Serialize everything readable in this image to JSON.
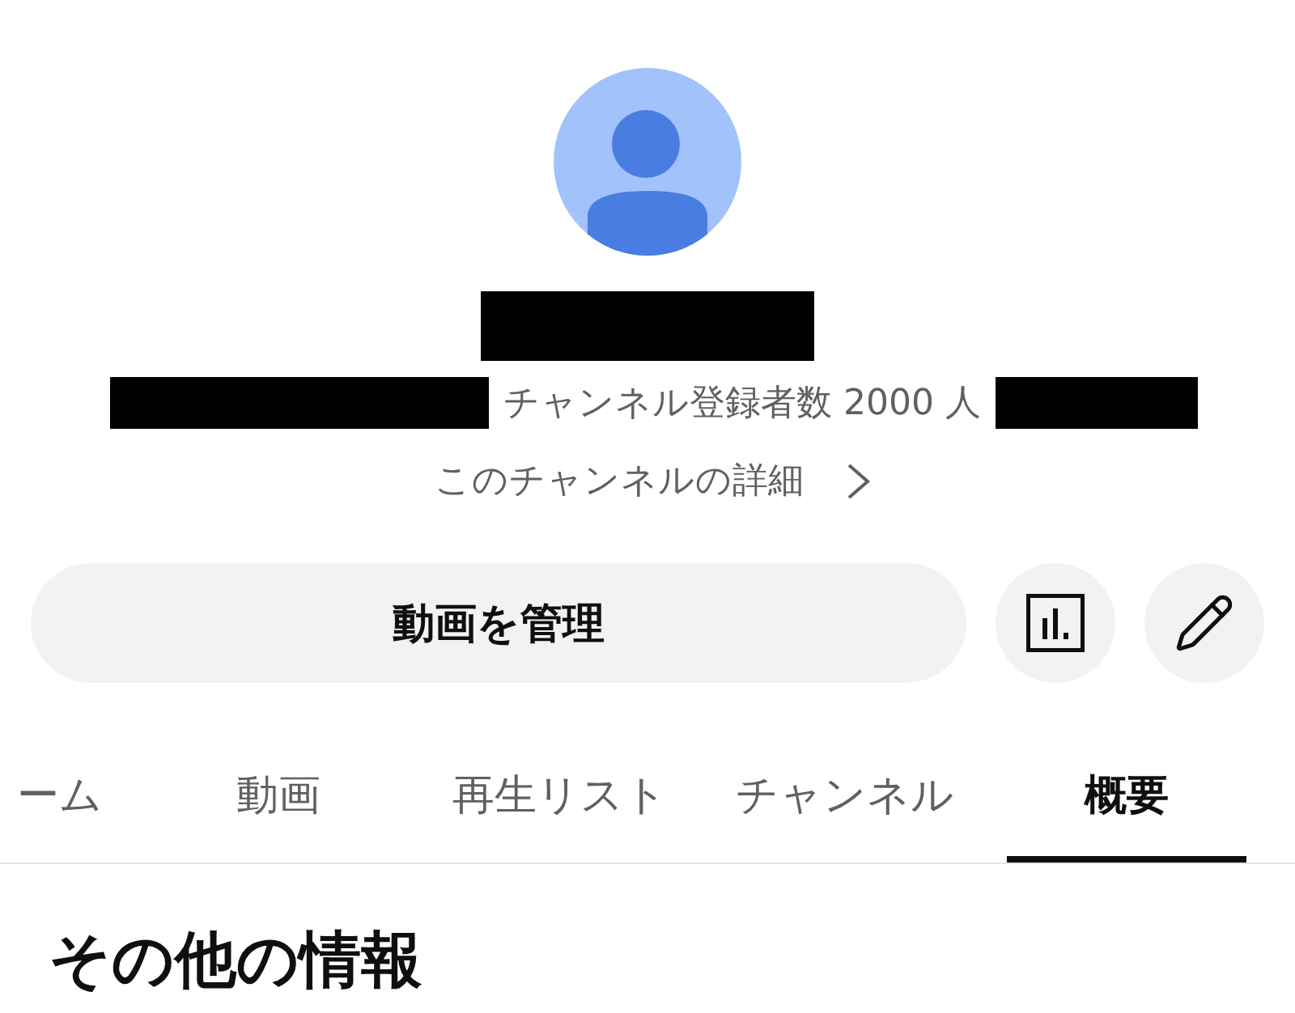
{
  "channel": {
    "subscribers": "チャンネル登録者数 2000 人",
    "details_link": "このチャンネルの詳細"
  },
  "actions": {
    "manage_button": "動画を管理"
  },
  "tabs": [
    {
      "label": "ーム",
      "selected": false
    },
    {
      "label": "動画",
      "selected": false
    },
    {
      "label": "再生リスト",
      "selected": false
    },
    {
      "label": "チャンネル",
      "selected": false
    },
    {
      "label": "概要",
      "selected": true
    }
  ],
  "section": {
    "title": "その他の情報"
  }
}
